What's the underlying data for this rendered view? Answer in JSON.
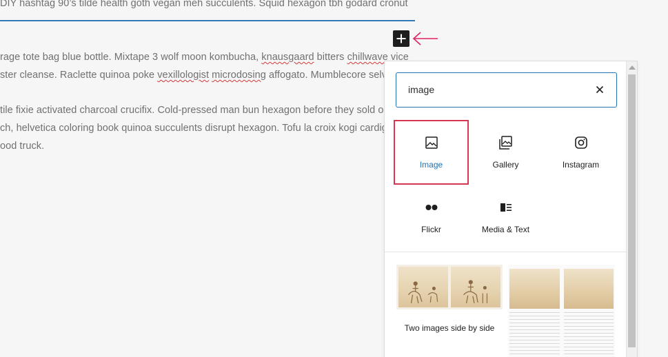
{
  "editor": {
    "line1": "DIY hashtag 90’s tilde health goth vegan meh succulents. Squid hexagon tbh godard cronut",
    "line2_a": "rage tote bag blue bottle. Mixtape 3 wolf moon kombucha, ",
    "line2_b": "knausgaard",
    "line2_c": " bitters ",
    "line2_d": "chillwave",
    "line2_e": " vice",
    "line3_a": "ster cleanse. Raclette quinoa poke ",
    "line3_b": "vexillologist",
    "line3_c": " ",
    "line3_d": "microdosing",
    "line3_e": " affogato. Mumblecore selv",
    "line4": "tile fixie activated charcoal crucifix. Cold-pressed man bun hexagon before they sold o",
    "line5": "ch, helvetica coloring book quinoa succulents disrupt hexagon. Tofu la croix kogi cardiga",
    "line6": "ood truck."
  },
  "inserter": {
    "search_value": "image",
    "blocks": [
      {
        "label": "Image",
        "icon": "image-icon",
        "selected": true
      },
      {
        "label": "Gallery",
        "icon": "gallery-icon",
        "selected": false
      },
      {
        "label": "Instagram",
        "icon": "instagram-icon",
        "selected": false
      },
      {
        "label": "Flickr",
        "icon": "flickr-icon",
        "selected": false
      },
      {
        "label": "Media & Text",
        "icon": "media-text-icon",
        "selected": false
      }
    ],
    "patterns": [
      {
        "label": "Two images side by side"
      }
    ]
  },
  "colors": {
    "accent": "#2271b1",
    "highlight": "#d63650",
    "annotation_arrow": "#e0245e"
  }
}
